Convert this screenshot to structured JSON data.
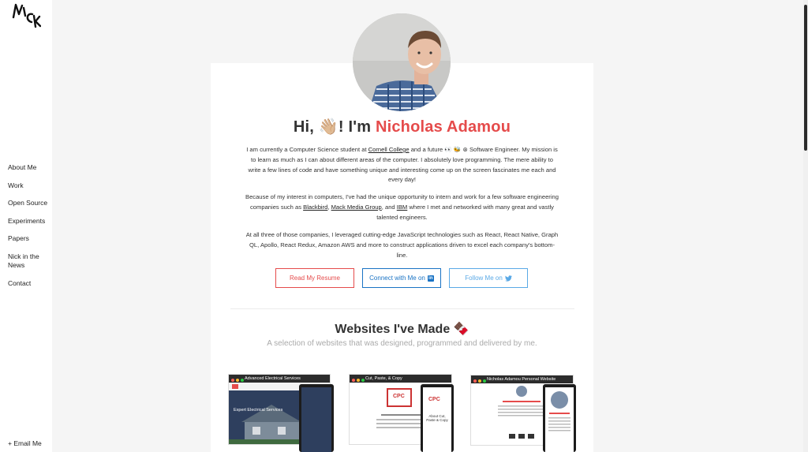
{
  "sidebar": {
    "logo_text": "Nick",
    "items": [
      {
        "label": "About Me"
      },
      {
        "label": "Work"
      },
      {
        "label": "Open Source"
      },
      {
        "label": "Experiments"
      },
      {
        "label": "Papers"
      },
      {
        "label": "Nick in the News"
      },
      {
        "label": "Contact"
      }
    ],
    "email_label": "+ Email Me"
  },
  "hero": {
    "greeting_pre": "Hi, ",
    "wave": "👋🏼",
    "greeting_mid": "! I'm ",
    "name": "Nicholas Adamou"
  },
  "bio": {
    "p1_a": "I am currently a Computer Science student at ",
    "p1_link": "Cornell College",
    "p1_b": " and a future 👀 🐝 ⊛ Software Engineer. My mission is to learn as much as I can about different areas of the computer. I absolutely love programming. The mere ability to write a few lines of code and have something unique and interesting come up on the screen fascinates me each and every day!",
    "p2_a": "Because of my interest in computers, I've had the unique opportunity to intern and work for a few software engineering companies such as ",
    "p2_link1": "Blackbird",
    "p2_b": ", ",
    "p2_link2": "Mack Media Group",
    "p2_c": ", and ",
    "p2_link3": "IBM",
    "p2_d": " where I met and networked with many great and vastly talented engineers.",
    "p3": "At all three of those companies, I leveraged cutting-edge JavaScript technologies such as React, React Native, Graph QL, Apollo, React Redux, Amazon AWS and more to construct applications driven to excel each company's bottom-line."
  },
  "buttons": {
    "resume": "Read My Resume",
    "linkedin": "Connect with Me on",
    "linkedin_icon": "in",
    "twitter": "Follow Me on"
  },
  "websites": {
    "title": "Websites I've Made 🍫",
    "subtitle": "A selection of websites that was designed, programmed and delivered by me.",
    "items": [
      {
        "name": "Advanced Electrical Services",
        "hero_text": "Expert Electrical Services"
      },
      {
        "name": "Cut, Paste, & Copy",
        "logo": "CPC",
        "caption": "About Cut, Paste & Copy"
      },
      {
        "name": "Nicholas Adamou Personal Website"
      }
    ]
  },
  "colors": {
    "accent": "#e54b4b",
    "linkedin": "#1a73c4",
    "twitter": "#5aa9e6"
  }
}
